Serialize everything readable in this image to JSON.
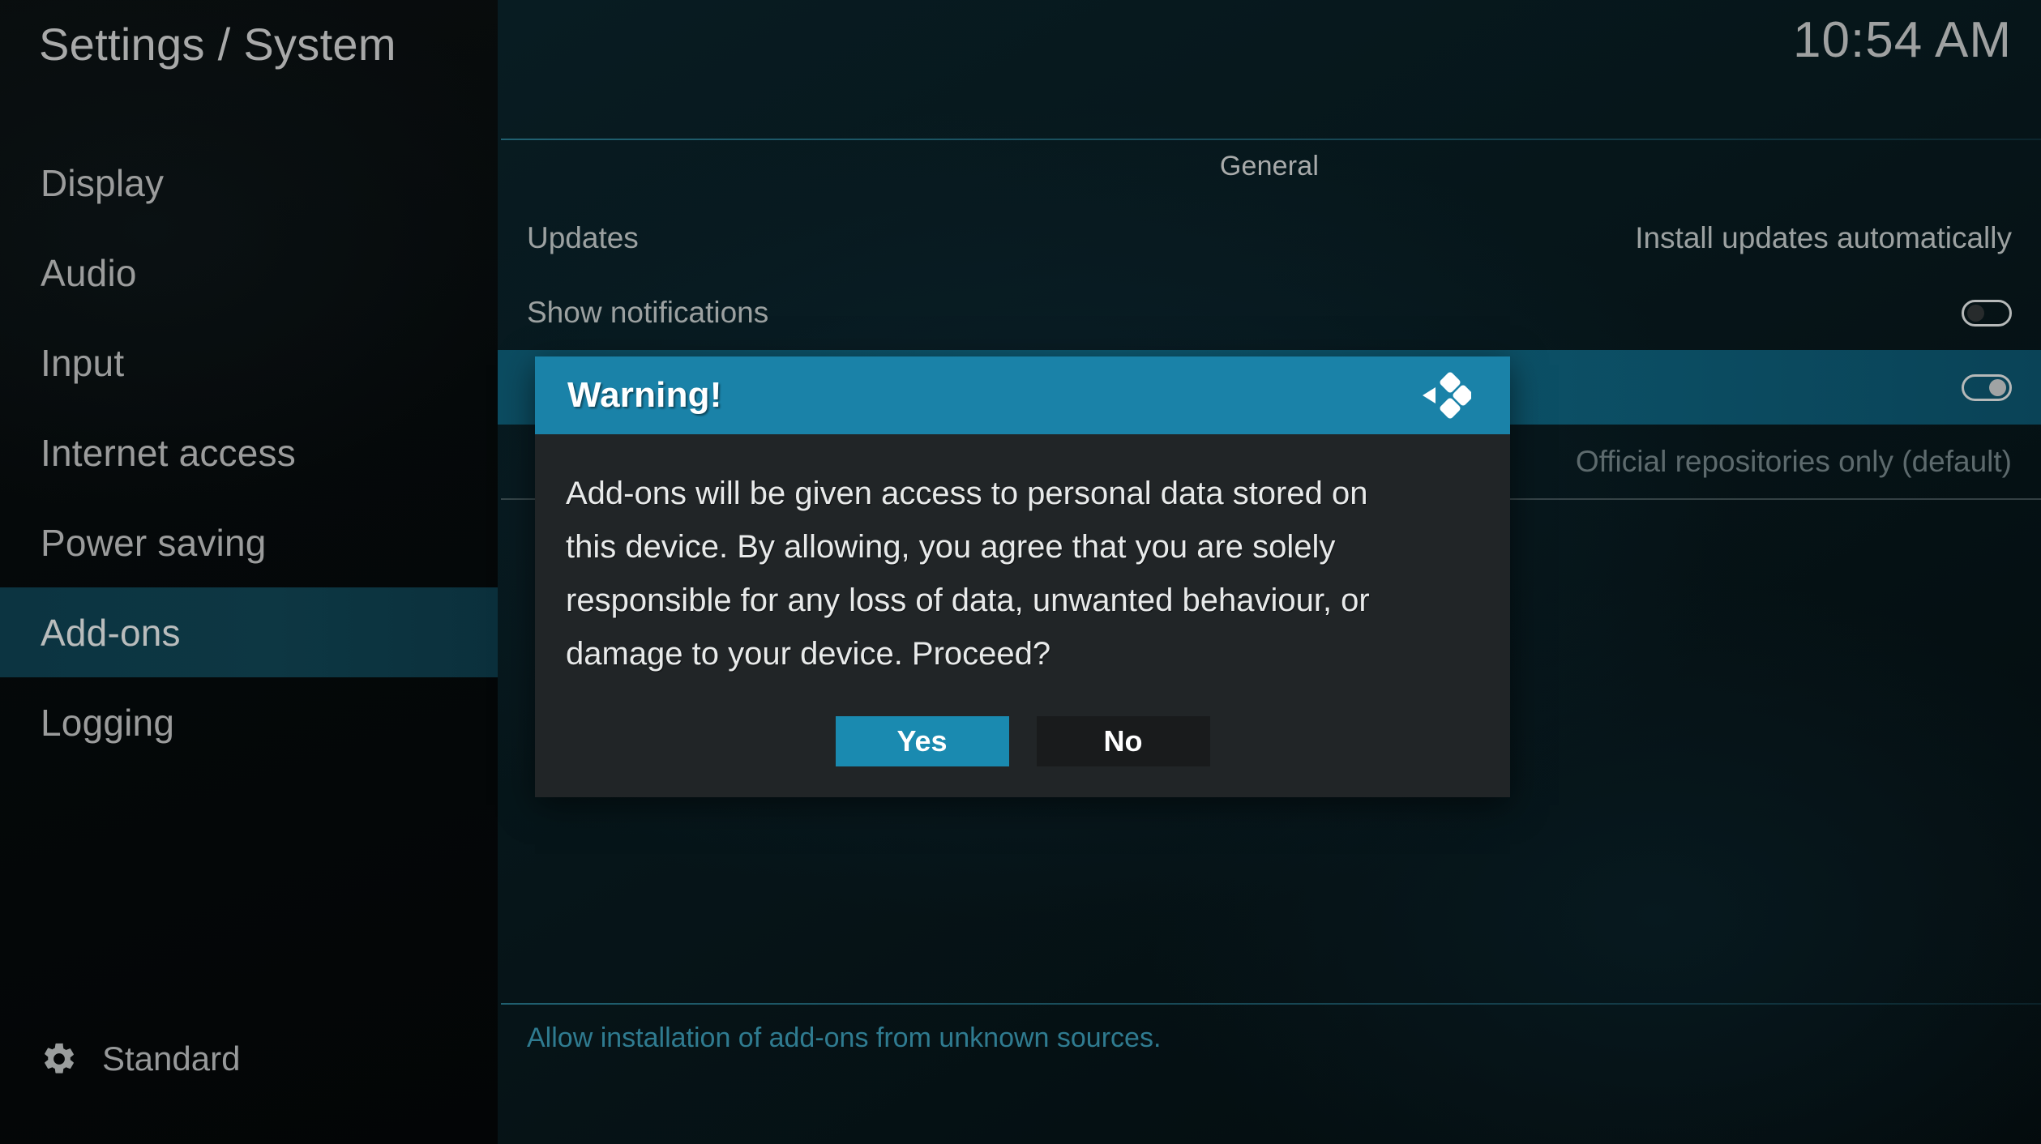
{
  "header": {
    "title": "Settings / System",
    "clock": "10:54 AM"
  },
  "sidebar": {
    "items": [
      {
        "label": "Display",
        "selected": false
      },
      {
        "label": "Audio",
        "selected": false
      },
      {
        "label": "Input",
        "selected": false
      },
      {
        "label": "Internet access",
        "selected": false
      },
      {
        "label": "Power saving",
        "selected": false
      },
      {
        "label": "Add-ons",
        "selected": true
      },
      {
        "label": "Logging",
        "selected": false
      }
    ],
    "profile": {
      "icon": "gear-icon",
      "label": "Standard"
    }
  },
  "main": {
    "section_title": "General",
    "rows": [
      {
        "label": "Updates",
        "value": "Install updates automatically",
        "control": "text",
        "highlight": false,
        "dim": false
      },
      {
        "label": "Show notifications",
        "value": "",
        "control": "toggle",
        "toggle_on": false,
        "highlight": false,
        "dim": false
      },
      {
        "label": "",
        "value": "",
        "control": "toggle",
        "toggle_on": true,
        "highlight": true,
        "dim": false
      },
      {
        "label": "",
        "value": "Official repositories only (default)",
        "control": "text",
        "highlight": false,
        "dim": true
      }
    ],
    "help_text": "Allow installation of add-ons from unknown sources."
  },
  "dialog": {
    "title": "Warning!",
    "logo_icon": "kodi-logo-icon",
    "message": "Add-ons will be given access to personal data stored on this device. By allowing, you agree that you are solely responsible for any loss of data, unwanted behaviour, or damage to your device. Proceed?",
    "buttons": {
      "yes": "Yes",
      "no": "No"
    }
  },
  "colors": {
    "accent_teal": "#1a82a8",
    "row_highlight": "#0d5a72",
    "sidebar_highlight": "#0d3743",
    "help_text": "#2f7b90"
  }
}
